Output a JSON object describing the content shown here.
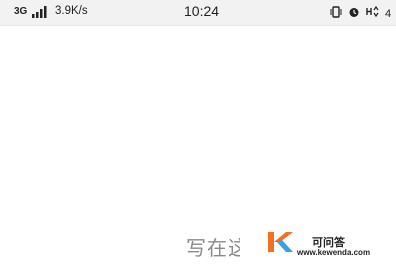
{
  "status_bar": {
    "network_label": "3G",
    "speed": "3.9K/s",
    "time": "10:24",
    "battery_partial": "4"
  },
  "editor": {
    "placeholder_partial": "写在这"
  },
  "watermark": {
    "title": "可问答",
    "site": "www.kewenda.com"
  }
}
